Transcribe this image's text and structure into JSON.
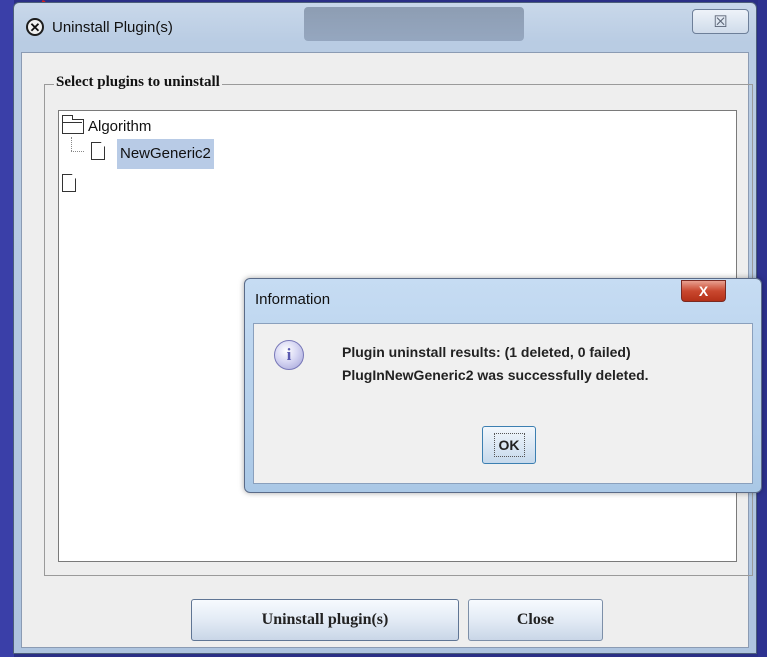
{
  "main_window": {
    "title": "Uninstall Plugin(s)",
    "close_glyph": "☒",
    "group_title": "Select plugins to uninstall",
    "tree": {
      "root_label": "Algorithm",
      "child_label": "NewGeneric2"
    },
    "buttons": {
      "uninstall": "Uninstall plugin(s)",
      "close": "Close"
    }
  },
  "info_dialog": {
    "title": "Information",
    "close_glyph": "X",
    "icon_glyph": "i",
    "message_line1": "Plugin uninstall results: (1 deleted, 0 failed)",
    "message_line2": "PlugInNewGeneric2 was successfully deleted.",
    "ok_label": "OK"
  }
}
